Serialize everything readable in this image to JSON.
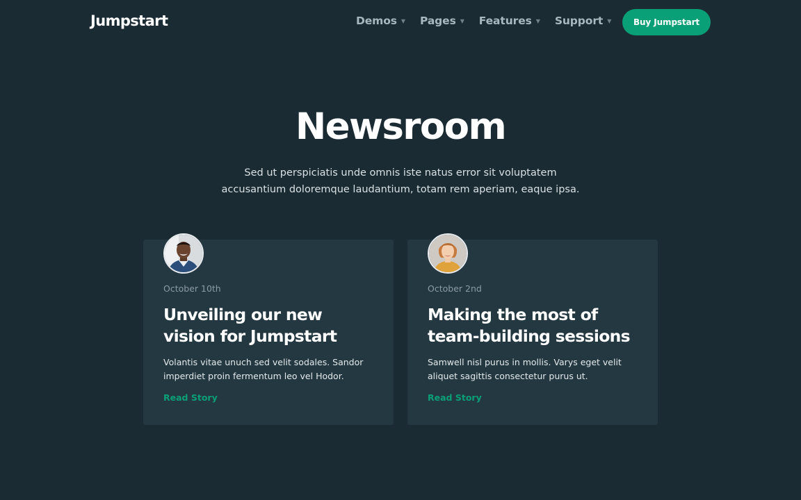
{
  "brand": {
    "name": "Jumpstart"
  },
  "nav": {
    "items": [
      {
        "label": "Demos",
        "icon": "caret-down-icon"
      },
      {
        "label": "Pages",
        "icon": "caret-down-icon"
      },
      {
        "label": "Features",
        "icon": "caret-down-icon"
      },
      {
        "label": "Support",
        "icon": "caret-down-icon"
      }
    ],
    "cta_label": "Buy Jumpstart"
  },
  "hero": {
    "title": "Newsroom",
    "subtitle_line1": "Sed ut perspiciatis unde omnis iste natus error sit voluptatem",
    "subtitle_line2": "accusantium doloremque laudantium, totam rem aperiam, eaque ipsa."
  },
  "stories": [
    {
      "avatar": "author-avatar-man",
      "date": "October 10th",
      "title": "Unveiling our new vision for Jumpstart",
      "excerpt": "Volantis vitae unuch sed velit sodales. Sandor imperdiet proin fermentum leo vel Hodor.",
      "link_label": "Read Story"
    },
    {
      "avatar": "author-avatar-woman",
      "date": "October 2nd",
      "title": "Making the most of team-building sessions",
      "excerpt": "Samwell nisl purus in mollis. Varys eget velit aliquet sagittis consectetur purus ut.",
      "link_label": "Read Story"
    }
  ],
  "colors": {
    "background": "#1a2b33",
    "card": "#243841",
    "accent": "#0aa077",
    "nav_text": "#a9b8bf"
  }
}
